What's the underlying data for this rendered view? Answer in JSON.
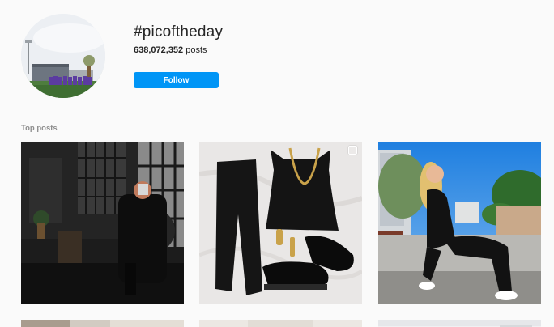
{
  "header": {
    "hashtag": "#picoftheday",
    "post_count": "638,072,352",
    "post_count_suffix": " posts",
    "follow_label": "Follow"
  },
  "sections": {
    "top_posts_label": "Top posts"
  },
  "colors": {
    "follow_button": "#0095f6",
    "background": "#fafafa",
    "muted_text": "#8e8e8e"
  },
  "posts": [
    {
      "description": "post-dark-interior-mirror-selfie"
    },
    {
      "description": "post-black-outfit-flatlay",
      "badge": "multi-photo-icon"
    },
    {
      "description": "post-woman-black-jumpsuit-rooftop"
    },
    {
      "description": "post-partial-row2-1"
    },
    {
      "description": "post-partial-row2-2"
    },
    {
      "description": "post-partial-row2-3"
    }
  ]
}
